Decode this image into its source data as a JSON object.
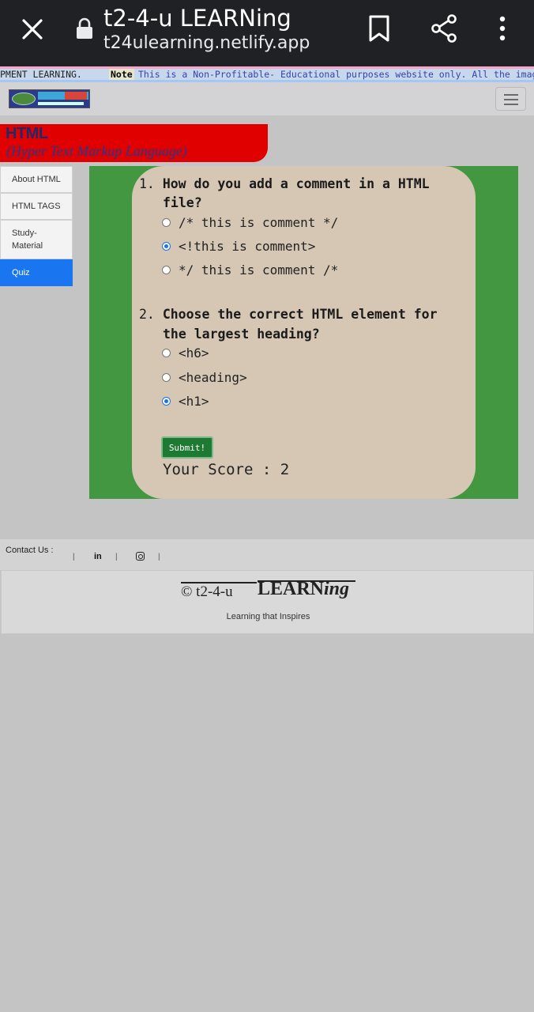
{
  "browser": {
    "title": "t2-4-u LEARNing",
    "url": "t24ulearning.netlify.app"
  },
  "marquee": {
    "prefix": "PMENT LEARNING.",
    "note_label": "Note",
    "message": "This is a Non-Profitable- Educational purposes website only. All the images"
  },
  "banner": {
    "title": "HTML",
    "subtitle": "(Hyper Text Markup Language)"
  },
  "sidebar": {
    "items": [
      {
        "label": "About HTML"
      },
      {
        "label": "HTML TAGS"
      },
      {
        "label_line1": "Study-",
        "label_line2": "Material"
      },
      {
        "label": "Quiz"
      }
    ]
  },
  "quiz": {
    "questions": [
      {
        "number": "1.",
        "text_line1": "How do you add a comment in a HTML",
        "text_line2": "file?",
        "options": [
          {
            "label": "/* this is comment */",
            "selected": false
          },
          {
            "label": "<!this is comment>",
            "selected": true
          },
          {
            "label": "*/ this is comment /*",
            "selected": false
          }
        ]
      },
      {
        "number": "2.",
        "text_line1": "Choose the correct HTML element for",
        "text_line2": "the largest heading?",
        "options": [
          {
            "label": "<h6>",
            "selected": false
          },
          {
            "label": "<heading>",
            "selected": false
          },
          {
            "label": "<h1>",
            "selected": true
          }
        ]
      }
    ],
    "submit_label": "Submit!",
    "score_text": "Your Score : 2"
  },
  "contact": {
    "label": "Contact Us :",
    "linkedin": "in"
  },
  "footer": {
    "copyright": "© t2-4-u",
    "brand_main": "LEARN",
    "brand_italic": "ing",
    "tagline": "Learning that Inspires"
  },
  "colors": {
    "banner": "#e00000",
    "green_panel": "#439741",
    "card": "#d5c7b4",
    "active_menu": "#1976f0",
    "submit": "#1e7a32"
  }
}
